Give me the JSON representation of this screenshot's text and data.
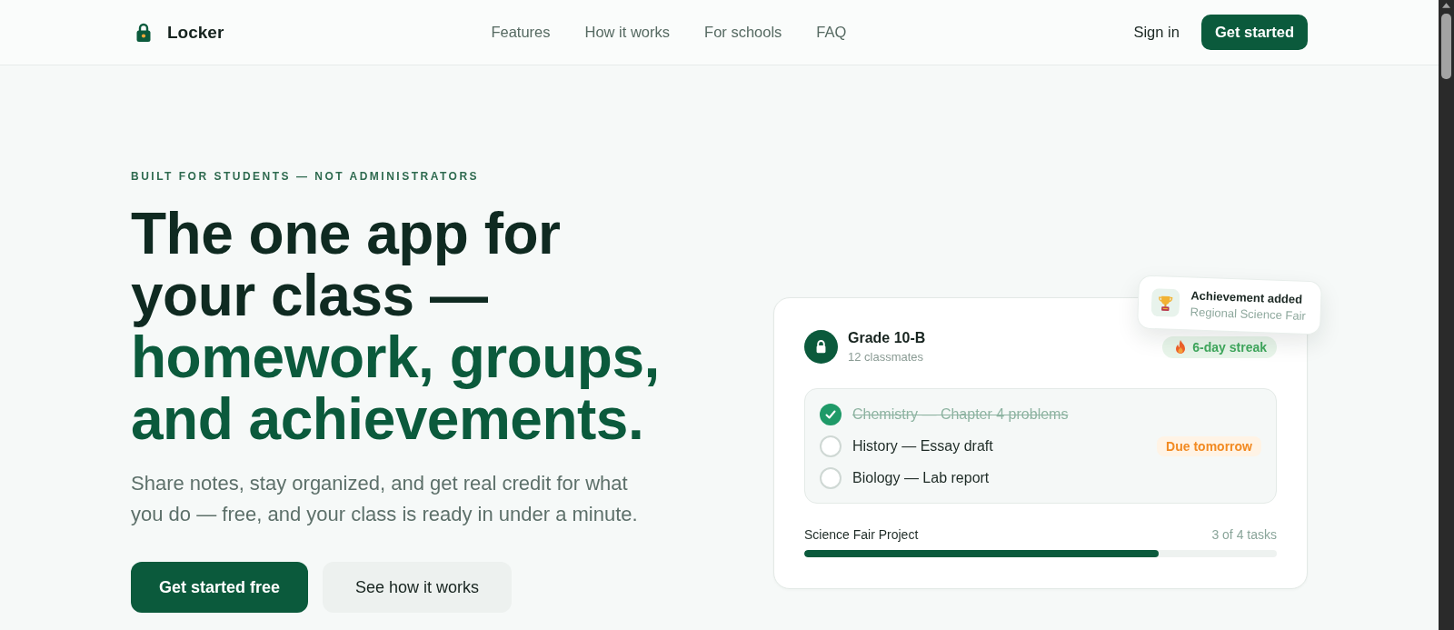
{
  "header": {
    "brand": "Locker",
    "nav": [
      "Features",
      "How it works",
      "For schools",
      "FAQ"
    ],
    "sign_in": "Sign in",
    "cta": "Get started"
  },
  "hero": {
    "eyebrow": "BUILT FOR STUDENTS — NOT ADMINISTRATORS",
    "headline": "The one app for your class —",
    "headline_accent": "homework, groups, and achievements.",
    "lead": "Share notes, stay organized, and get real credit for what you do — free, and your class is ready in under a minute.",
    "buttons": [
      {
        "label": "Get started free",
        "kind": "primary"
      },
      {
        "label": "See how it works",
        "kind": "secondary"
      }
    ]
  },
  "card": {
    "title": "Grade 10-B",
    "subtitle": "12 classmates",
    "streak": "6-day streak",
    "toast": {
      "title": "Achievement added",
      "subtitle": "Regional Science Fair"
    },
    "tasks": [
      {
        "label": "Chemistry — Chapter 4 problems",
        "checked": true
      },
      {
        "label": "History — Essay draft",
        "checked": false,
        "badge": "Due tomorrow"
      },
      {
        "label": "Biology — Lab report",
        "checked": false
      }
    ],
    "progress": {
      "label": "Science Fair Project",
      "reading": "3 of 4 tasks",
      "level": 0.75
    }
  }
}
